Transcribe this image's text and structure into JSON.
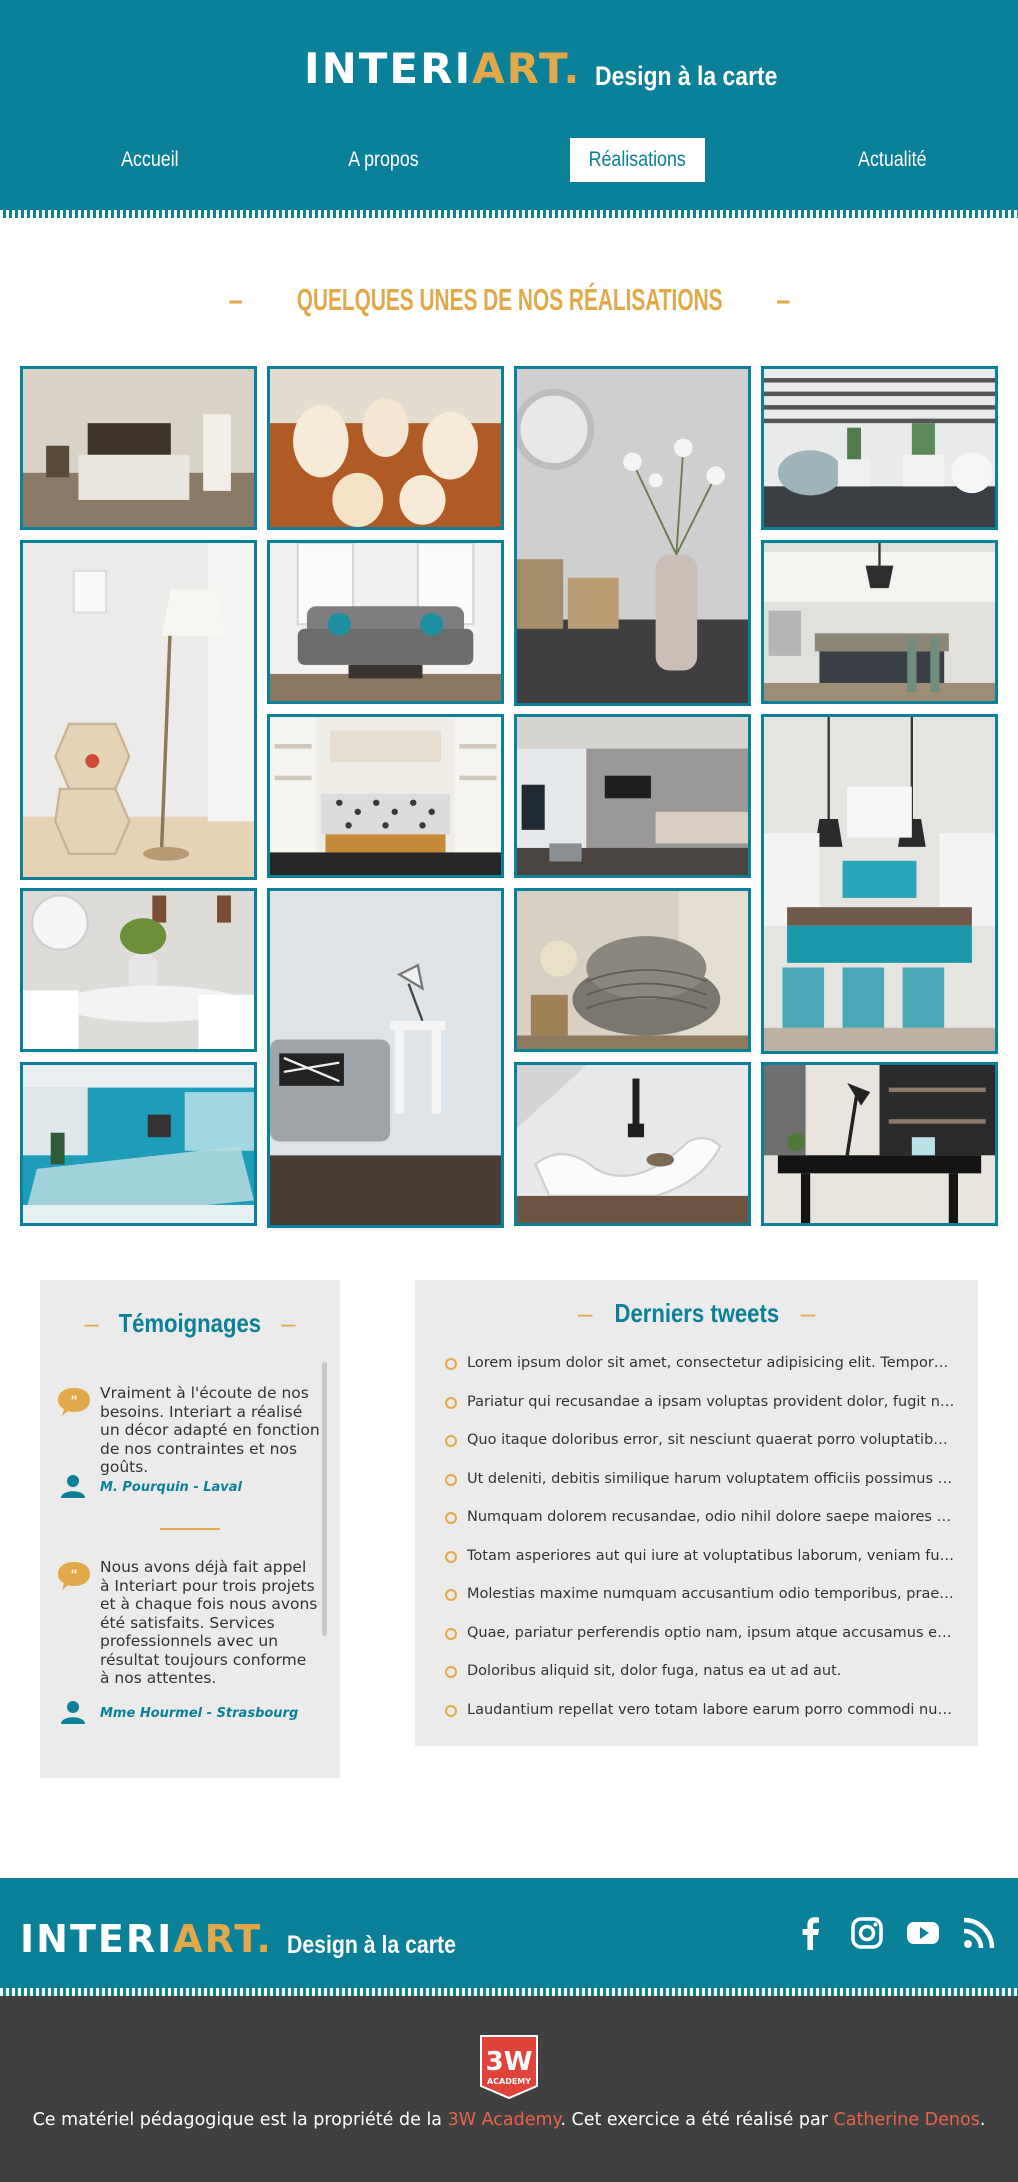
{
  "header": {
    "logo_main": "INTERI",
    "logo_accent": "ART.",
    "tagline": "Design à la carte"
  },
  "nav": {
    "items": [
      "Accueil",
      "A propos",
      "Réalisations",
      "Actualité"
    ],
    "active": "Réalisations"
  },
  "gallery": {
    "title": "QUELQUES UNES DE NOS RÉALISATIONS",
    "photos": [
      "bedroom",
      "pendant-lamps",
      "vase-flowers",
      "cactus-pots",
      "floor-lamp",
      "sofa-living",
      "kitchen-island",
      "kitchen-shelves",
      "bedroom-tv",
      "kitchen-blue",
      "white-tulips",
      "sofa-lamp",
      "armchair",
      "office-blue",
      "chaise-longue",
      "desk"
    ]
  },
  "testimonials": {
    "title": "Témoignages",
    "items": [
      {
        "text": "Vraiment à l'écoute de nos besoins. Interiart a réalisé un décor adapté en fonction de nos contraintes et nos goûts.",
        "author": "M. Pourquin - Laval"
      },
      {
        "text": "Nous avons déjà fait appel à Interiart pour trois projets et à chaque fois nous avons été satisfaits. Services professionnels avec un résultat toujours conforme à nos attentes.",
        "author": "Mme Hourmel - Strasbourg"
      }
    ]
  },
  "tweets": {
    "title": "Derniers tweets",
    "items": [
      "Lorem ipsum dolor sit amet, consectetur adipisicing elit. Tempora, dolores.",
      "Pariatur qui recusandae a ipsam voluptas provident dolor, fugit nemo.",
      "Quo itaque doloribus error, sit nesciunt quaerat porro voluptatibus iusto.",
      "Ut deleniti, debitis similique harum voluptatem officiis possimus vel.",
      "Numquam dolorem recusandae, odio nihil dolore saepe maiores accusamus.",
      "Totam asperiores aut qui iure at voluptatibus laborum, veniam fugit.",
      "Molestias maxime numquam accusantium odio temporibus, praesentium.",
      "Quae, pariatur perferendis optio nam, ipsum atque accusamus et ullam.",
      "Doloribus aliquid sit, dolor fuga, natus ea ut ad aut.",
      "Laudantium repellat vero totam labore earum porro commodi numquam."
    ]
  },
  "footer": {
    "logo_main": "INTERI",
    "logo_accent": "ART.",
    "tagline": "Design à la carte",
    "socials": [
      "facebook-icon",
      "instagram-icon",
      "youtube-icon",
      "rss-icon"
    ],
    "badge_line1": "3W",
    "badge_line2": "ACADEMY",
    "credit_before": "Ce matériel pédagogique est la propriété de la ",
    "credit_link1": "3W Academy",
    "credit_middle": ". Cet exercice a été réalisé par ",
    "credit_link2": "Catherine Denos",
    "credit_after": "."
  },
  "colors": {
    "primary": "#0b8099",
    "accent": "#e2a94b",
    "link": "#ea6248",
    "footer_dark": "#404040",
    "panel": "#ebebeb"
  }
}
